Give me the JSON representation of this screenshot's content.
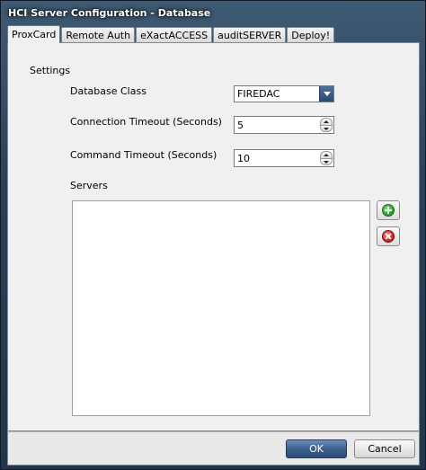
{
  "window": {
    "title": "HCI Server Configuration - Database"
  },
  "tabs": [
    {
      "label": "ProxCard",
      "active": true
    },
    {
      "label": "Remote Auth",
      "active": false
    },
    {
      "label": "eXactACCESS",
      "active": false
    },
    {
      "label": "auditSERVER",
      "active": false
    },
    {
      "label": "Deploy!",
      "active": false
    }
  ],
  "settings": {
    "group_label": "Settings",
    "database_class": {
      "label": "Database Class",
      "value": "FIREDAC"
    },
    "connection_timeout": {
      "label": "Connection Timeout (Seconds)",
      "value": "5"
    },
    "command_timeout": {
      "label": "Command Timeout (Seconds)",
      "value": "10"
    },
    "servers": {
      "label": "Servers",
      "items": []
    }
  },
  "icons": {
    "add": "add-circle-icon",
    "remove": "remove-circle-icon"
  },
  "footer": {
    "ok_label": "OK",
    "cancel_label": "Cancel"
  },
  "colors": {
    "ok_button": "#3b5f8f",
    "add_icon": "#1f9a1f",
    "remove_icon": "#c41a1a"
  }
}
